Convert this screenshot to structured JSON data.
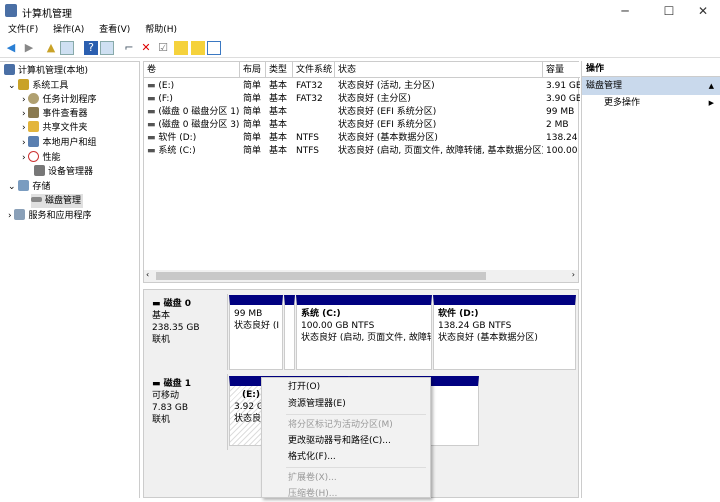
{
  "window": {
    "title": "计算机管理",
    "minimize": "─",
    "maximize": "☐",
    "close": "✕"
  },
  "menu": [
    "文件(F)",
    "操作(A)",
    "查看(V)",
    "帮助(H)"
  ],
  "tree": {
    "root": "计算机管理(本地)",
    "items": [
      "系统工具",
      "任务计划程序",
      "事件查看器",
      "共享文件夹",
      "本地用户和组",
      "性能",
      "设备管理器",
      "存储",
      "磁盘管理",
      "服务和应用程序"
    ]
  },
  "volumes": {
    "headers": [
      "卷",
      "布局",
      "类型",
      "文件系统",
      "状态",
      "容量"
    ],
    "rows": [
      [
        "(E:)",
        "简单",
        "基本",
        "FAT32",
        "状态良好 (活动, 主分区)",
        "3.91 GB"
      ],
      [
        "(F:)",
        "简单",
        "基本",
        "FAT32",
        "状态良好 (主分区)",
        "3.90 GB"
      ],
      [
        "(磁盘 0 磁盘分区 1)",
        "简单",
        "基本",
        "",
        "状态良好 (EFI 系统分区)",
        "99 MB"
      ],
      [
        "(磁盘 0 磁盘分区 3)",
        "简单",
        "基本",
        "",
        "状态良好 (EFI 系统分区)",
        "2 MB"
      ],
      [
        "软件 (D:)",
        "简单",
        "基本",
        "NTFS",
        "状态良好 (基本数据分区)",
        "138.24"
      ],
      [
        "系统 (C:)",
        "简单",
        "基本",
        "NTFS",
        "状态良好 (启动, 页面文件, 故障转储, 基本数据分区)",
        "100.00"
      ]
    ]
  },
  "disks": [
    {
      "name": "磁盘 0",
      "type": "基本",
      "size": "238.35 GB",
      "status": "联机",
      "parts": [
        {
          "title": "",
          "size": "99 MB",
          "status": "状态良好 (I"
        },
        {
          "title": "系统  (C:)",
          "size": "100.00 GB NTFS",
          "status": "状态良好 (启动, 页面文件, 故障转"
        },
        {
          "title": "软件  (D:)",
          "size": "138.24 GB NTFS",
          "status": "状态良好 (基本数据分区)"
        }
      ]
    },
    {
      "name": "磁盘 1",
      "type": "可移动",
      "size": "7.83 GB",
      "status": "联机",
      "parts": [
        {
          "title": "(E:)",
          "size": "3.92 G",
          "status": "状态良"
        }
      ]
    }
  ],
  "actions": {
    "header": "操作",
    "section": "磁盘管理",
    "more": "更多操作"
  },
  "context_menu": [
    "打开(O)",
    "资源管理器(E)",
    "将分区标记为活动分区(M)",
    "更改驱动器号和路径(C)...",
    "格式化(F)...",
    "扩展卷(X)...",
    "压缩卷(H)..."
  ]
}
